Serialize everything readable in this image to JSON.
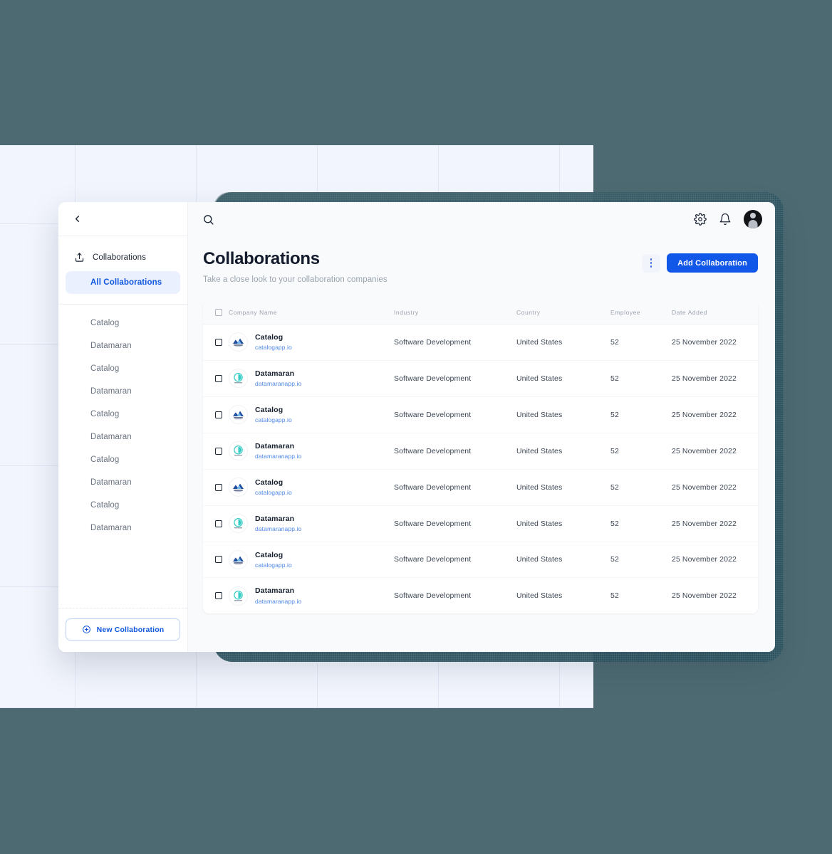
{
  "theme": {
    "page_bg": "#4d6a72",
    "backdrop_bg": "#f2f5fd",
    "accent_blue": "#1258e8",
    "link_blue": "#4d87e8",
    "muted_text": "#9aa3ad",
    "texture_shape": "#2f5763"
  },
  "sidebar": {
    "back_icon": "chevron-left-icon",
    "section": {
      "icon": "upload-icon",
      "label": "Collaborations"
    },
    "active_item": "All Collaborations",
    "items": [
      {
        "label": "Catalog"
      },
      {
        "label": "Datamaran"
      },
      {
        "label": "Catalog"
      },
      {
        "label": "Datamaran"
      },
      {
        "label": "Catalog"
      },
      {
        "label": "Datamaran"
      },
      {
        "label": "Catalog"
      },
      {
        "label": "Datamaran"
      },
      {
        "label": "Catalog"
      },
      {
        "label": "Datamaran"
      }
    ],
    "new_button": {
      "label": "New Collaboration",
      "icon": "plus-circle-icon"
    }
  },
  "topbar": {
    "search_icon": "search-icon",
    "settings_icon": "gear-icon",
    "notifications_icon": "bell-icon",
    "avatar": "user-avatar"
  },
  "header": {
    "title": "Collaborations",
    "subtitle": "Take a close look to your collaboration companies",
    "kebab_icon": "more-vertical-icon",
    "add_button": "Add Collaboration"
  },
  "table": {
    "columns": [
      "Company Name",
      "Industry",
      "Country",
      "Employee",
      "Date Added"
    ],
    "rows": [
      {
        "logo": "catalog-logo",
        "name": "Catalog",
        "site": "catalogapp.io",
        "industry": "Software Development",
        "country": "United States",
        "employee": "52",
        "date": "25 November 2022"
      },
      {
        "logo": "datamaran-logo",
        "name": "Datamaran",
        "site": "datamaranapp.io",
        "industry": "Software Development",
        "country": "United States",
        "employee": "52",
        "date": "25 November 2022"
      },
      {
        "logo": "catalog-logo",
        "name": "Catalog",
        "site": "catalogapp.io",
        "industry": "Software Development",
        "country": "United States",
        "employee": "52",
        "date": "25 November 2022"
      },
      {
        "logo": "datamaran-logo",
        "name": "Datamaran",
        "site": "datamaranapp.io",
        "industry": "Software Development",
        "country": "United States",
        "employee": "52",
        "date": "25 November 2022"
      },
      {
        "logo": "catalog-logo",
        "name": "Catalog",
        "site": "catalogapp.io",
        "industry": "Software Development",
        "country": "United States",
        "employee": "52",
        "date": "25 November 2022"
      },
      {
        "logo": "datamaran-logo",
        "name": "Datamaran",
        "site": "datamaranapp.io",
        "industry": "Software Development",
        "country": "United States",
        "employee": "52",
        "date": "25 November 2022"
      },
      {
        "logo": "catalog-logo",
        "name": "Catalog",
        "site": "catalogapp.io",
        "industry": "Software Development",
        "country": "United States",
        "employee": "52",
        "date": "25 November 2022"
      },
      {
        "logo": "datamaran-logo",
        "name": "Datamaran",
        "site": "datamaranapp.io",
        "industry": "Software Development",
        "country": "United States",
        "employee": "52",
        "date": "25 November 2022"
      }
    ]
  }
}
